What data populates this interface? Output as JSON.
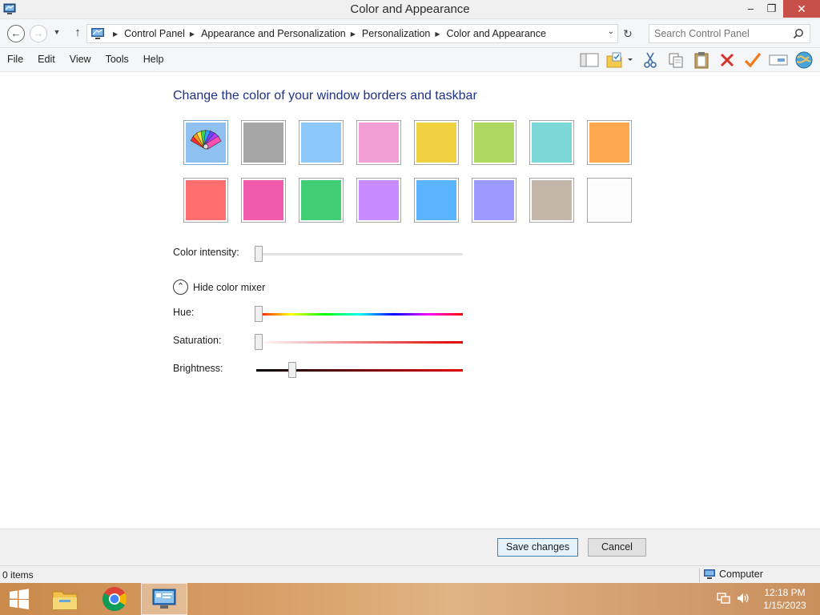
{
  "window": {
    "title": "Color and Appearance",
    "buttons": {
      "minimize": "–",
      "maximize": "❐",
      "close": "✕"
    }
  },
  "nav": {
    "breadcrumbs": [
      "Control Panel",
      "Appearance and Personalization",
      "Personalization",
      "Color and Appearance"
    ],
    "search_placeholder": "Search Control Panel"
  },
  "menu": [
    "File",
    "Edit",
    "View",
    "Tools",
    "Help"
  ],
  "toolbar_icons": [
    "layout-icon",
    "properties-icon",
    "cut-icon",
    "copy-icon",
    "paste-icon",
    "delete-icon",
    "checkmark-icon",
    "rename-icon",
    "globe-icon"
  ],
  "content": {
    "heading": "Change the color of your window borders and taskbar",
    "swatches": [
      {
        "name": "automatic",
        "color": "#8fc1f0",
        "selected": true
      },
      {
        "name": "gray",
        "color": "#a6a6a6"
      },
      {
        "name": "sky-blue",
        "color": "#8cc8fa"
      },
      {
        "name": "pink",
        "color": "#f29fd6"
      },
      {
        "name": "yellow",
        "color": "#f0d240"
      },
      {
        "name": "green",
        "color": "#aed960"
      },
      {
        "name": "teal",
        "color": "#7cd8d6"
      },
      {
        "name": "orange",
        "color": "#ffa84f"
      },
      {
        "name": "coral",
        "color": "#ff6e6e"
      },
      {
        "name": "magenta",
        "color": "#f25aae"
      },
      {
        "name": "emerald",
        "color": "#40cd74"
      },
      {
        "name": "lavender",
        "color": "#c88cff"
      },
      {
        "name": "blue",
        "color": "#5ab4ff"
      },
      {
        "name": "periwinkle",
        "color": "#9b9bff"
      },
      {
        "name": "taupe",
        "color": "#c4b7aa"
      },
      {
        "name": "white",
        "color": "#fcfcfc"
      }
    ],
    "color_intensity_label": "Color intensity:",
    "color_intensity": 0,
    "mixer_toggle_label": "Hide color mixer",
    "hue_label": "Hue:",
    "hue": 0,
    "saturation_label": "Saturation:",
    "saturation": 0,
    "brightness_label": "Brightness:",
    "brightness": 0.17
  },
  "footer": {
    "save_label": "Save changes",
    "cancel_label": "Cancel"
  },
  "status": {
    "items": "0 items",
    "location": "Computer"
  },
  "taskbar": {
    "time": "12:18 PM",
    "date": "1/15/2023"
  }
}
